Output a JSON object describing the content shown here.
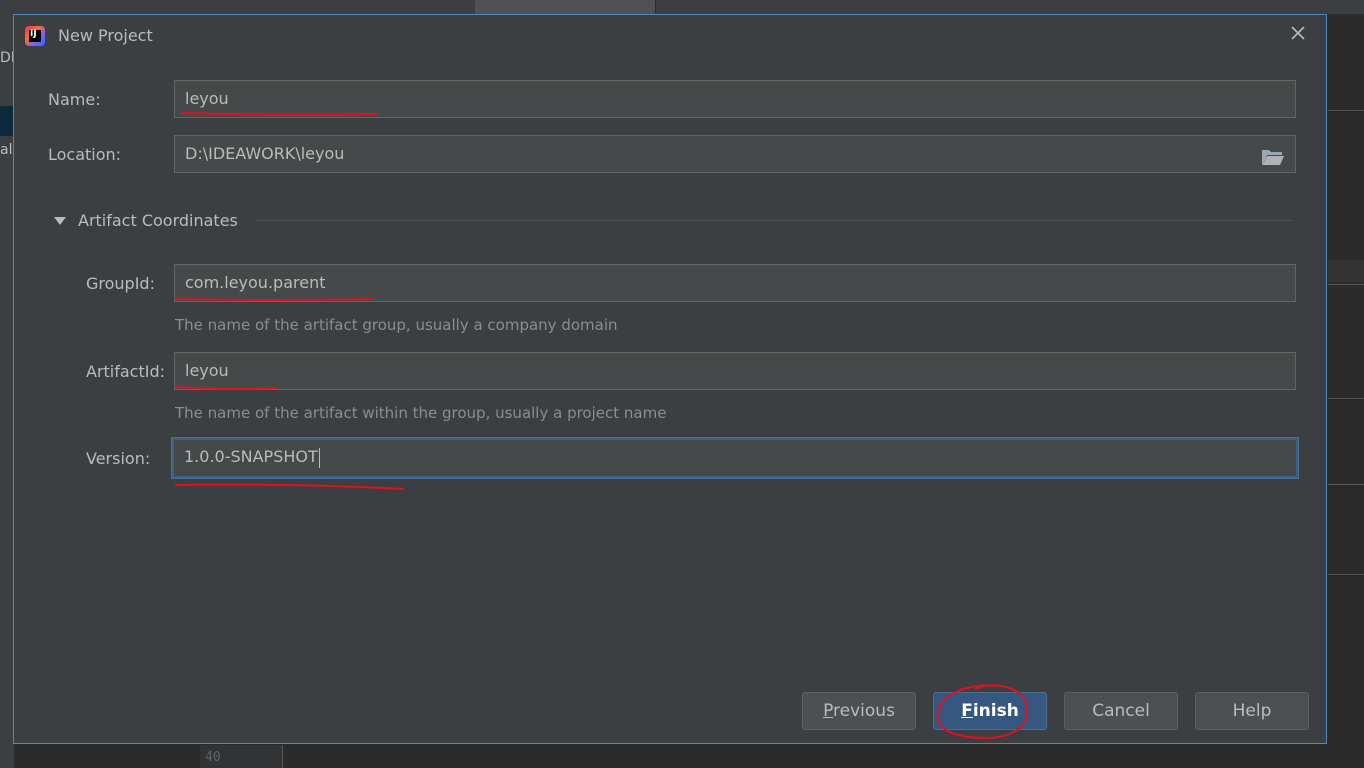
{
  "dialog": {
    "title": "New Project"
  },
  "form": {
    "name_label": "Name:",
    "name_value": "leyou",
    "location_label": "Location:",
    "location_value": "D:\\IDEAWORK\\leyou",
    "section_title": "Artifact Coordinates",
    "groupid_label": "GroupId:",
    "groupid_value": "com.leyou.parent",
    "groupid_hint": "The name of the artifact group, usually a company domain",
    "artifactid_label": "ArtifactId:",
    "artifactid_value": "leyou",
    "artifactid_hint": "The name of the artifact within the group, usually a project name",
    "version_label": "Version:",
    "version_value": "1.0.0-SNAPSHOT"
  },
  "buttons": {
    "previous_first": "P",
    "previous_rest": "revious",
    "finish_first": "F",
    "finish_rest": "inish",
    "cancel": "Cancel",
    "help": "Help"
  },
  "background": {
    "left_fragment_1": "DE",
    "left_fragment_2": "al",
    "gutter_line": "40"
  },
  "colors": {
    "dialog_bg": "#3c3f41",
    "field_bg": "#45494a",
    "focus_border": "#3d6185",
    "default_button": "#365880",
    "annotation_red": "#e0111d"
  },
  "icons": {
    "app": "intellij-idea-icon",
    "close": "close-icon",
    "browse": "folder-icon",
    "section": "triangle-down-icon"
  }
}
